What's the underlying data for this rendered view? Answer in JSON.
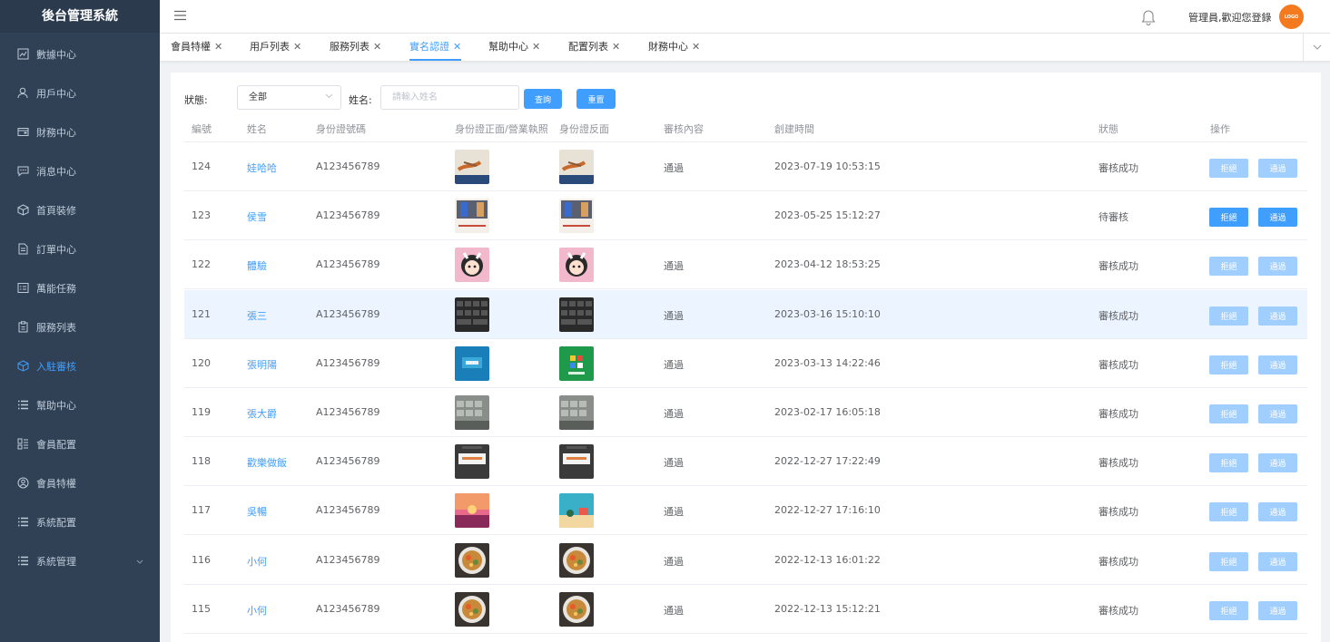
{
  "app": {
    "title": "後台管理系統"
  },
  "sidebar": {
    "items": [
      {
        "label": "數據中心",
        "icon": "chart-icon"
      },
      {
        "label": "用戶中心",
        "icon": "user-icon"
      },
      {
        "label": "財務中心",
        "icon": "wallet-icon"
      },
      {
        "label": "消息中心",
        "icon": "message-icon"
      },
      {
        "label": "首頁裝修",
        "icon": "cube-icon"
      },
      {
        "label": "訂單中心",
        "icon": "document-icon"
      },
      {
        "label": "萬能任務",
        "icon": "task-icon"
      },
      {
        "label": "服務列表",
        "icon": "clipboard-icon"
      },
      {
        "label": "入駐審核",
        "icon": "cube-icon",
        "active": true
      },
      {
        "label": "幫助中心",
        "icon": "list-icon"
      },
      {
        "label": "會員配置",
        "icon": "grid-icon"
      },
      {
        "label": "會員特權",
        "icon": "user-circle-icon"
      },
      {
        "label": "系統配置",
        "icon": "list-icon"
      },
      {
        "label": "系統管理",
        "icon": "list-icon",
        "expandable": true
      }
    ]
  },
  "header": {
    "welcome": "管理員,歡迎您登錄",
    "avatar_text": "LOGO"
  },
  "tabs": [
    {
      "label": "會員特權"
    },
    {
      "label": "用戶列表"
    },
    {
      "label": "服務列表"
    },
    {
      "label": "實名認證",
      "active": true
    },
    {
      "label": "幫助中心"
    },
    {
      "label": "配置列表"
    },
    {
      "label": "財務中心"
    }
  ],
  "filter": {
    "status_label": "狀態:",
    "status_value": "全部",
    "name_label": "姓名:",
    "name_placeholder": "請輸入姓名",
    "query_button": "查詢",
    "reset_button": "重置"
  },
  "table": {
    "headers": [
      "編號",
      "姓名",
      "身份證號碼",
      "身份證正面/營業執照",
      "身份證反面",
      "審核內容",
      "創建時間",
      "狀態",
      "操作"
    ],
    "reject_label": "拒絕",
    "approve_label": "通過",
    "rows": [
      {
        "id": "124",
        "name": "娃哈哈",
        "idno": "A123456789",
        "content": "通過",
        "created": "2023-07-19 10:53:15",
        "status": "審核成功",
        "pending": false,
        "thumb": "drawing"
      },
      {
        "id": "123",
        "name": "侯雪",
        "idno": "A123456789",
        "content": "",
        "created": "2023-05-25 15:12:27",
        "status": "待審核",
        "pending": true,
        "thumb": "screen"
      },
      {
        "id": "122",
        "name": "體驗",
        "idno": "A123456789",
        "content": "通過",
        "created": "2023-04-12 18:53:25",
        "status": "審核成功",
        "pending": false,
        "thumb": "avatar"
      },
      {
        "id": "121",
        "name": "張三",
        "idno": "A123456789",
        "content": "通過",
        "created": "2023-03-16 15:10:10",
        "status": "審核成功",
        "pending": false,
        "thumb": "keyboard",
        "highlight": true
      },
      {
        "id": "120",
        "name": "張明陽",
        "idno": "A123456789",
        "content": "通過",
        "created": "2023-03-13 14:22:46",
        "status": "審核成功",
        "pending": false,
        "thumb": "logo"
      },
      {
        "id": "119",
        "name": "張大爵",
        "idno": "A123456789",
        "content": "通過",
        "created": "2023-02-17 16:05:18",
        "status": "審核成功",
        "pending": false,
        "thumb": "keys"
      },
      {
        "id": "118",
        "name": "歡樂做飯",
        "idno": "A123456789",
        "content": "通過",
        "created": "2022-12-27 17:22:49",
        "status": "審核成功",
        "pending": false,
        "thumb": "phone"
      },
      {
        "id": "117",
        "name": "吳暢",
        "idno": "A123456789",
        "content": "通過",
        "created": "2022-12-27 17:16:10",
        "status": "審核成功",
        "pending": false,
        "thumb": "sunset"
      },
      {
        "id": "116",
        "name": "小何",
        "idno": "A123456789",
        "content": "通過",
        "created": "2022-12-13 16:01:22",
        "status": "審核成功",
        "pending": false,
        "thumb": "food"
      },
      {
        "id": "115",
        "name": "小何",
        "idno": "A123456789",
        "content": "通過",
        "created": "2022-12-13 15:12:21",
        "status": "審核成功",
        "pending": false,
        "thumb": "food"
      }
    ]
  }
}
